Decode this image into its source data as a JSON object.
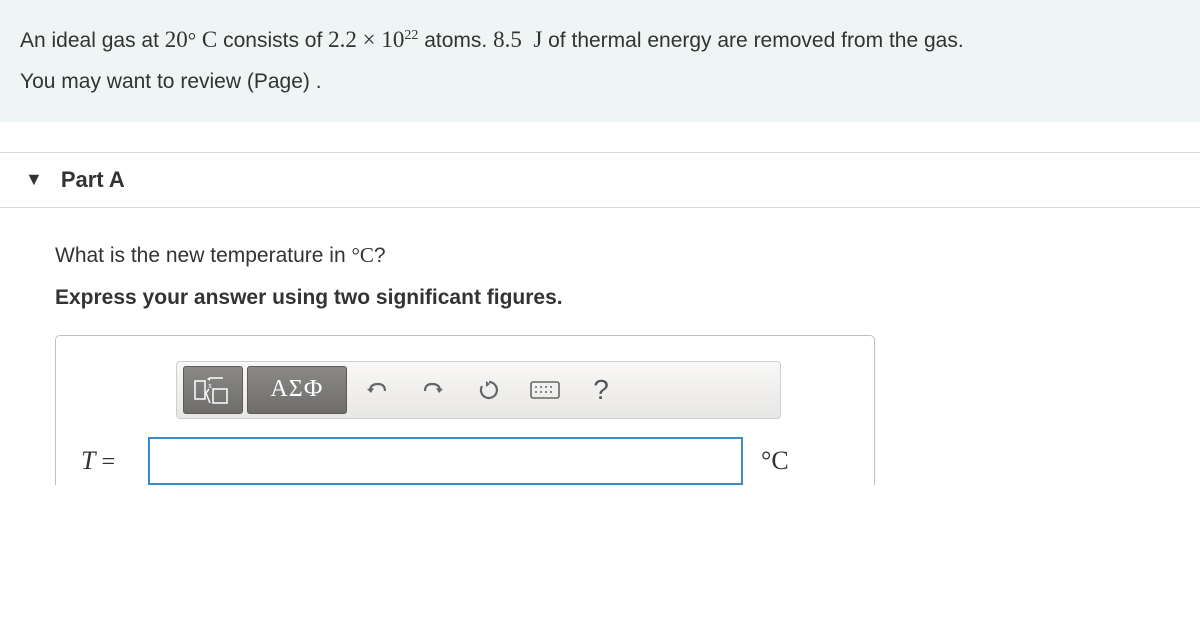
{
  "problem": {
    "pre_temp": "An ideal gas at ",
    "temp_val": "20",
    "temp_unit": " C",
    "pre_atoms": " consists of ",
    "atoms_base": "2.2 × 10",
    "atoms_exp": "22",
    "pre_energy": " atoms. ",
    "energy_val": "8.5",
    "energy_unit": " J",
    "post_energy": " of thermal energy are removed from the gas.",
    "review_line": "You may want to review (Page) ."
  },
  "part": {
    "label": "Part A",
    "question_pre": "What is the new temperature in ",
    "question_unit": "C",
    "question_post": "?",
    "instruction": "Express your answer using two significant figures.",
    "variable": "T",
    "equals": " = ",
    "answer_value": "",
    "unit_label": "C"
  },
  "toolbar": {
    "templates": "templates",
    "greek": "ΑΣФ",
    "help": "?"
  }
}
